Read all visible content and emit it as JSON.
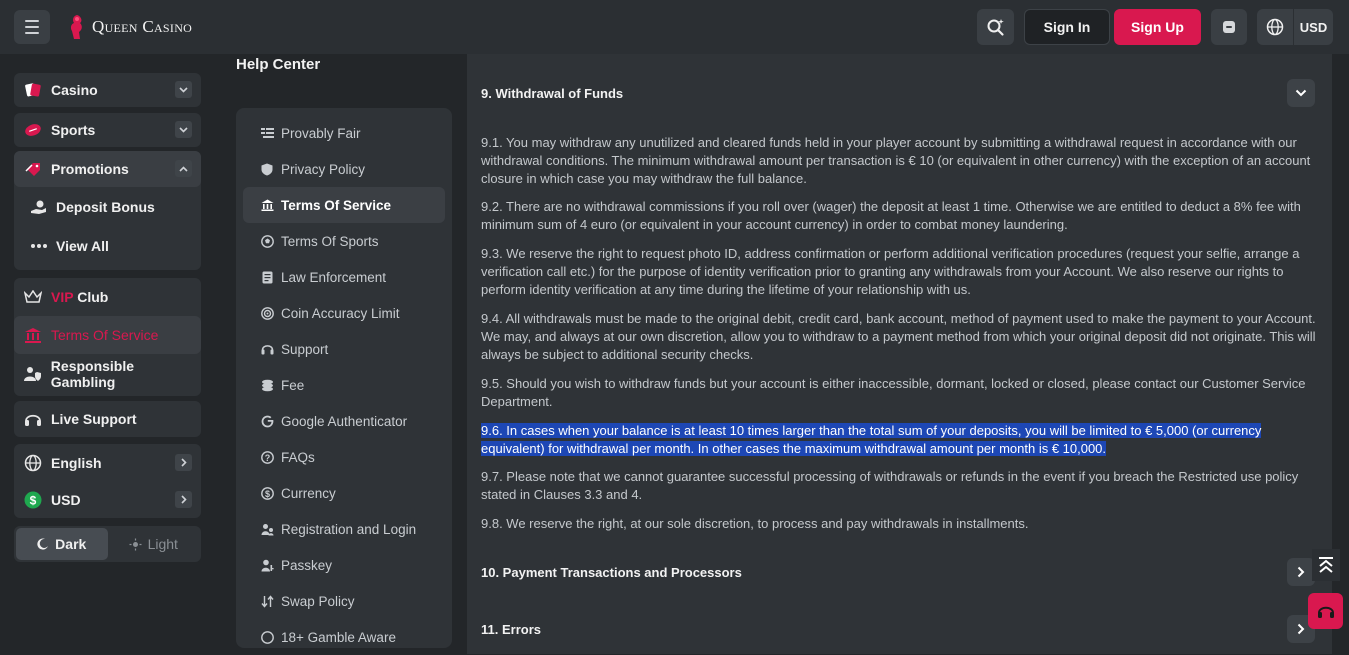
{
  "header": {
    "logo_text": "Queen Casino",
    "signin_label": "Sign In",
    "signup_label": "Sign Up",
    "currency": "USD",
    "icons": [
      "menu-icon",
      "search-icon",
      "wallet-icon",
      "globe-icon"
    ]
  },
  "sidebar": {
    "casino": "Casino",
    "sports": "Sports",
    "promotions": "Promotions",
    "deposit_bonus": "Deposit Bonus",
    "view_all": "View All",
    "vip_prefix": "VIP",
    "vip_suffix": " Club",
    "terms": "Terms Of Service",
    "responsible": "Responsible Gambling",
    "live_support": "Live Support",
    "language": "English",
    "currency": "USD",
    "theme_dark": "Dark",
    "theme_light": "Light"
  },
  "help": {
    "title": "Help Center",
    "items": [
      "Provably Fair",
      "Privacy Policy",
      "Terms Of Service",
      "Terms Of Sports",
      "Law Enforcement",
      "Coin Accuracy Limit",
      "Support",
      "Fee",
      "Google Authenticator",
      "FAQs",
      "Currency",
      "Registration and Login",
      "Passkey",
      "Swap Policy",
      "18+ Gamble Aware"
    ],
    "active_index": 2
  },
  "content": {
    "section9_title": "9. Withdrawal of Funds",
    "paragraphs": [
      "9.1. You may withdraw any unutilized and cleared funds held in your player account by submitting a withdrawal request in accordance with our withdrawal conditions. The minimum withdrawal amount per transaction is € 10 (or equivalent in other currency) with the exception of an account closure in which case you may withdraw the full balance.",
      "9.2. There are no withdrawal commissions if you roll over (wager) the deposit at least 1 time. Otherwise we are entitled to deduct a 8% fee with minimum sum of 4 euro (or equivalent in your account currency) in order to combat money laundering.",
      "9.3. We reserve the right to request photo ID, address confirmation or perform additional verification procedures (request your selfie, arrange a verification call etc.) for the purpose of identity verification prior to granting any withdrawals from your Account. We also reserve our rights to perform identity verification at any time during the lifetime of your relationship with us.",
      "9.4. All withdrawals must be made to the original debit, credit card, bank account, method of payment used to make the payment to your Account. We may, and always at our own discretion, allow you to withdraw to a payment method from which your original deposit did not originate. This will always be subject to additional security checks.",
      "9.5. Should you wish to withdraw funds but your account is either inaccessible, dormant, locked or closed, please contact our Customer Service Department.",
      "9.6. In cases when your balance is at least 10 times larger than the total sum of your deposits, you will be limited to € 5,000 (or currency equivalent) for withdrawal per month. In other cases the maximum withdrawal amount per month is € 10,000.",
      "9.7. Please note that we cannot guarantee successful processing of withdrawals or refunds in the event if you breach the Restricted use policy stated in Clauses 3.3 and 4.",
      "9.8. We reserve the right, at our sole discretion, to process and pay withdrawals in installments."
    ],
    "section10_title": "10. Payment Transactions and Processors",
    "section11_title": "11. Errors"
  }
}
